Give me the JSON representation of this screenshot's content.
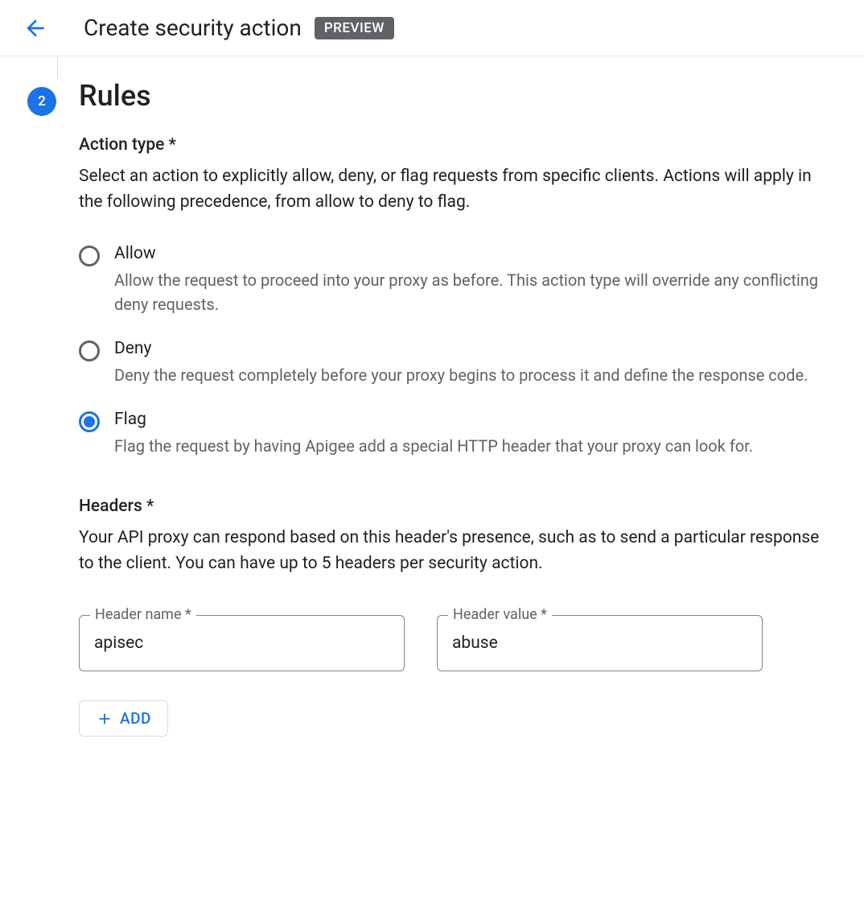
{
  "header": {
    "title": "Create security action",
    "badge": "PREVIEW"
  },
  "step": {
    "number": "2",
    "title": "Rules"
  },
  "action_type": {
    "label": "Action type *",
    "description": "Select an action to explicitly allow, deny, or flag requests from specific clients. Actions will apply in the following precedence, from allow to deny to flag.",
    "options": [
      {
        "value": "allow",
        "label": "Allow",
        "description": "Allow the request to proceed into your proxy as before. This action type will override any conflicting deny requests.",
        "selected": false
      },
      {
        "value": "deny",
        "label": "Deny",
        "description": "Deny the request completely before your proxy begins to process it and define the response code.",
        "selected": false
      },
      {
        "value": "flag",
        "label": "Flag",
        "description": "Flag the request by having Apigee add a special HTTP header that your proxy can look for.",
        "selected": true
      }
    ]
  },
  "headers": {
    "label": "Headers *",
    "description": "Your API proxy can respond based on this header's presence, such as to send a particular response to the client. You can have up to 5 headers per security action.",
    "name_label": "Header name *",
    "value_label": "Header value *",
    "rows": [
      {
        "name": "apisec",
        "value": "abuse"
      }
    ],
    "add_button": "ADD"
  }
}
